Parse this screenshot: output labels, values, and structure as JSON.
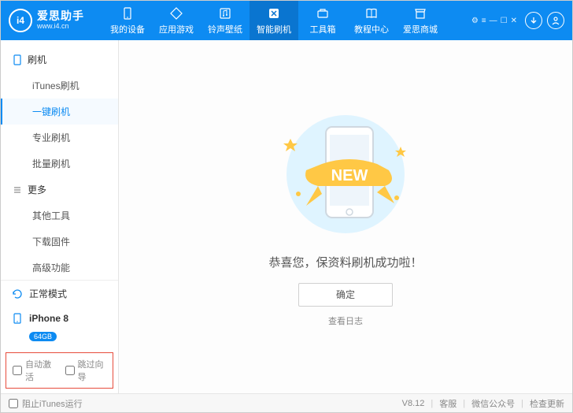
{
  "brand": {
    "name": "爱思助手",
    "url": "www.i4.cn",
    "logo_label": "i4"
  },
  "tabs": [
    {
      "label": "我的设备"
    },
    {
      "label": "应用游戏"
    },
    {
      "label": "铃声壁纸"
    },
    {
      "label": "智能刷机"
    },
    {
      "label": "工具箱"
    },
    {
      "label": "教程中心"
    },
    {
      "label": "爱思商城"
    }
  ],
  "sidebar": {
    "section1": {
      "title": "刷机"
    },
    "items1": [
      {
        "label": "iTunes刷机"
      },
      {
        "label": "一键刷机"
      },
      {
        "label": "专业刷机"
      },
      {
        "label": "批量刷机"
      }
    ],
    "section2": {
      "title": "更多"
    },
    "items2": [
      {
        "label": "其他工具"
      },
      {
        "label": "下载固件"
      },
      {
        "label": "高级功能"
      }
    ],
    "mode": "正常模式",
    "device": {
      "name": "iPhone 8",
      "storage": "64GB"
    },
    "checkbox1": "自动激活",
    "checkbox2": "跳过向导"
  },
  "main": {
    "message": "恭喜您，保资料刷机成功啦！",
    "ok": "确定",
    "log": "查看日志",
    "ribbon": "NEW"
  },
  "footer": {
    "stop_itunes": "阻止iTunes运行",
    "version": "V8.12",
    "support": "客服",
    "wechat": "微信公众号",
    "update": "检查更新"
  }
}
